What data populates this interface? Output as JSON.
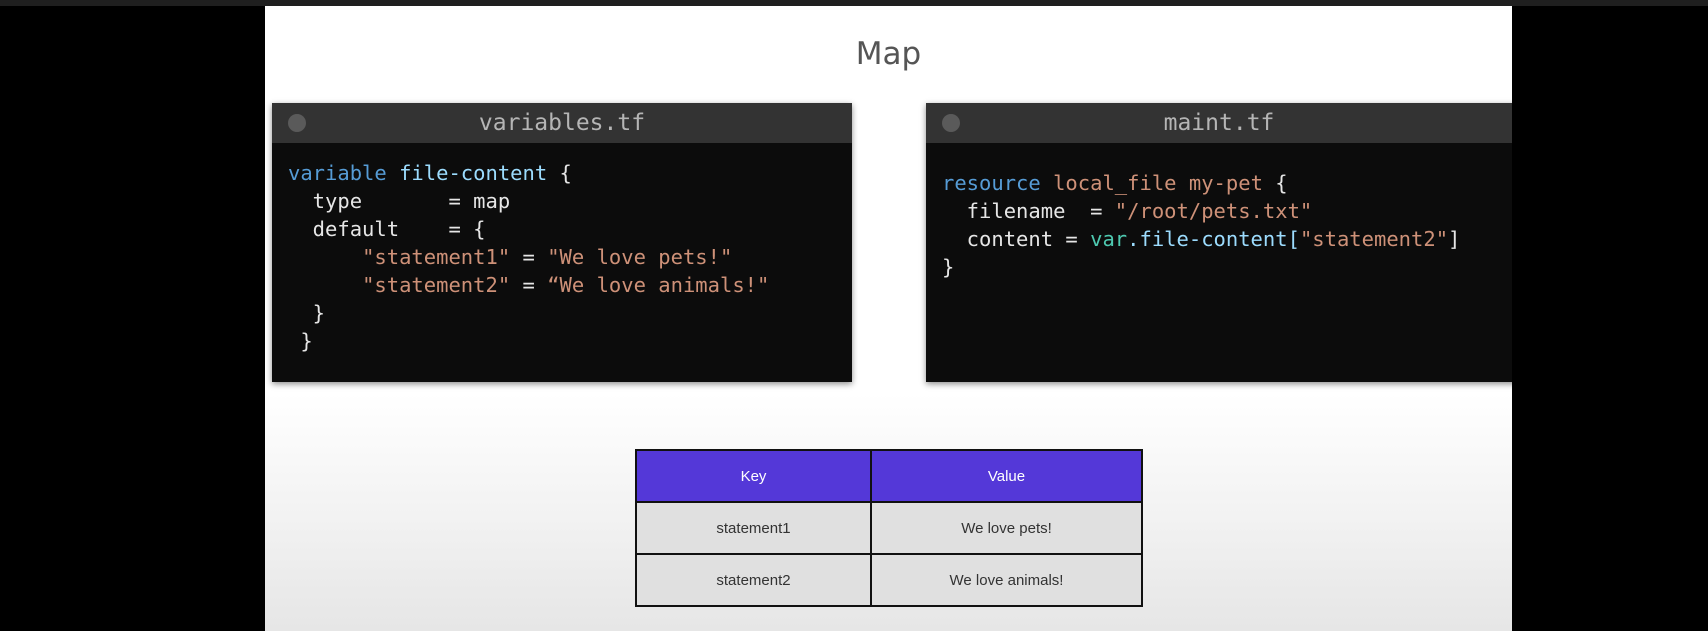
{
  "slide": {
    "title": "Map"
  },
  "left_editor": {
    "filename": "variables.tf",
    "line1": {
      "kw": "variable",
      "name": "file-content",
      "rest": " {"
    },
    "line2": "  type       = map",
    "line3": "  default    = {",
    "line4": {
      "key": "\"statement1\"",
      "eq": " = ",
      "val": "\"We love pets!\""
    },
    "line5": {
      "key": "\"statement2\"",
      "eq": " = ",
      "val": "“We love animals!\""
    },
    "line6": "  }",
    "line7": " }"
  },
  "right_editor": {
    "filename": "maint.tf",
    "line1": {
      "kw": "resource",
      "type": "local_file",
      "name": "my-pet",
      "rest": " {"
    },
    "line2": {
      "lead": "  filename  = ",
      "val": "\"/root/pets.txt\""
    },
    "line3": {
      "lead": "  content = ",
      "var": "var",
      "prop": ".file-content[",
      "key": "\"statement2\"",
      "close": "]"
    },
    "line4": "}"
  },
  "table": {
    "headers": [
      "Key",
      "Value"
    ],
    "rows": [
      [
        "statement1",
        "We love pets!"
      ],
      [
        "statement2",
        "We love animals!"
      ]
    ]
  },
  "colors": {
    "table_header": "#5438d8",
    "editor_background": "#0c0c0c",
    "keyword": "#569cd6",
    "string": "#ce9178"
  }
}
